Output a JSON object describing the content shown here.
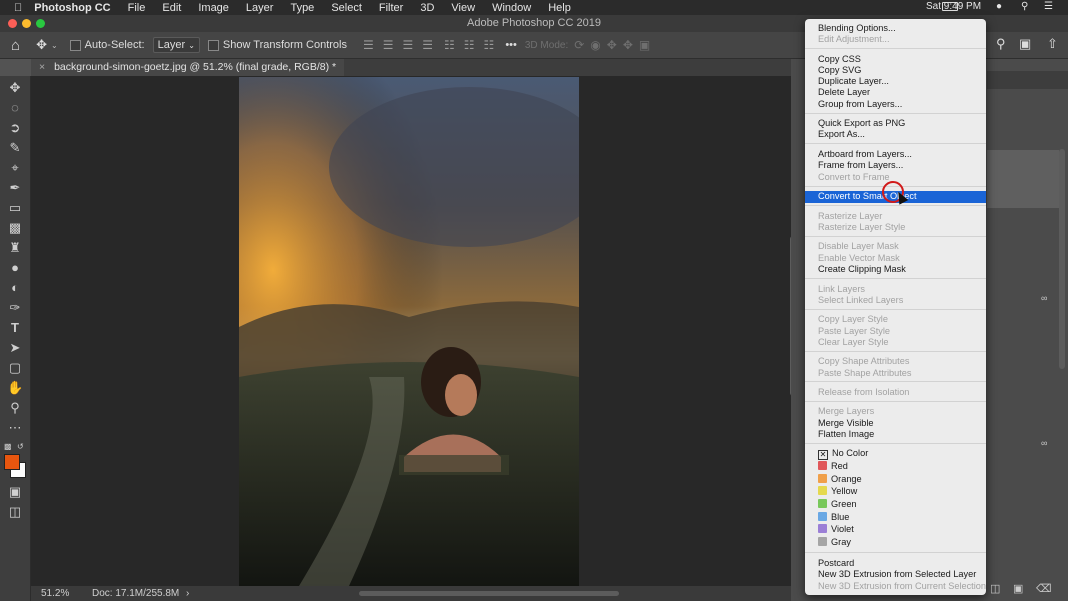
{
  "menubar": {
    "app": "Photoshop CC",
    "items": [
      "File",
      "Edit",
      "Image",
      "Layer",
      "Type",
      "Select",
      "Filter",
      "3D",
      "View",
      "Window",
      "Help"
    ],
    "clock": "Sat 9:49 PM"
  },
  "window_title": "Adobe Photoshop CC 2019",
  "options_bar": {
    "auto_select_label": "Auto-Select:",
    "auto_select_value": "Layer",
    "show_transform_label": "Show Transform Controls",
    "mode_3d_label": "3D Mode:",
    "more": "•••"
  },
  "document_tab": {
    "title": "background-simon-goetz.jpg @ 51.2% (final grade, RGB/8) *",
    "close": "×"
  },
  "status_bar": {
    "zoom": "51.2%",
    "doc_size": "Doc: 17.1M/255.8M",
    "arrow": "›"
  },
  "colors": {
    "foreground": "#e8560f",
    "background": "#ffffff",
    "menu_highlight": "#1a64d6"
  },
  "context_menu": {
    "items": [
      {
        "label": "Blending Options...",
        "enabled": true
      },
      {
        "label": "Edit Adjustment...",
        "enabled": false
      },
      {
        "label": "Copy CSS",
        "enabled": true
      },
      {
        "label": "Copy SVG",
        "enabled": true
      },
      {
        "label": "Duplicate Layer...",
        "enabled": true
      },
      {
        "label": "Delete Layer",
        "enabled": true
      },
      {
        "label": "Group from Layers...",
        "enabled": true
      },
      {
        "label": "Quick Export as PNG",
        "enabled": true
      },
      {
        "label": "Export As...",
        "enabled": true
      },
      {
        "label": "Artboard from Layers...",
        "enabled": true
      },
      {
        "label": "Frame from Layers...",
        "enabled": true
      },
      {
        "label": "Convert to Frame",
        "enabled": false
      },
      {
        "label": "Convert to Smart Object",
        "enabled": true,
        "highlighted": true
      },
      {
        "label": "Rasterize Layer",
        "enabled": false
      },
      {
        "label": "Rasterize Layer Style",
        "enabled": false
      },
      {
        "label": "Disable Layer Mask",
        "enabled": false
      },
      {
        "label": "Enable Vector Mask",
        "enabled": false
      },
      {
        "label": "Create Clipping Mask",
        "enabled": true
      },
      {
        "label": "Link Layers",
        "enabled": false
      },
      {
        "label": "Select Linked Layers",
        "enabled": false
      },
      {
        "label": "Copy Layer Style",
        "enabled": false
      },
      {
        "label": "Paste Layer Style",
        "enabled": false
      },
      {
        "label": "Clear Layer Style",
        "enabled": false
      },
      {
        "label": "Copy Shape Attributes",
        "enabled": false
      },
      {
        "label": "Paste Shape Attributes",
        "enabled": false
      },
      {
        "label": "Release from Isolation",
        "enabled": false
      },
      {
        "label": "Merge Layers",
        "enabled": false
      },
      {
        "label": "Merge Visible",
        "enabled": true
      },
      {
        "label": "Flatten Image",
        "enabled": true
      },
      {
        "label": "No Color",
        "enabled": true,
        "checked": true
      },
      {
        "label": "Red",
        "enabled": true,
        "swatch": "#e0575a"
      },
      {
        "label": "Orange",
        "enabled": true,
        "swatch": "#f0a04a"
      },
      {
        "label": "Yellow",
        "enabled": true,
        "swatch": "#e5d94e"
      },
      {
        "label": "Green",
        "enabled": true,
        "swatch": "#79c85b"
      },
      {
        "label": "Blue",
        "enabled": true,
        "swatch": "#6aa8e4"
      },
      {
        "label": "Violet",
        "enabled": true,
        "swatch": "#9b7fd6"
      },
      {
        "label": "Gray",
        "enabled": true,
        "swatch": "#a5a5a5"
      },
      {
        "label": "Postcard",
        "enabled": true
      },
      {
        "label": "New 3D Extrusion from Selected Layer",
        "enabled": true
      },
      {
        "label": "New 3D Extrusion from Current Selection",
        "enabled": false
      }
    ]
  }
}
